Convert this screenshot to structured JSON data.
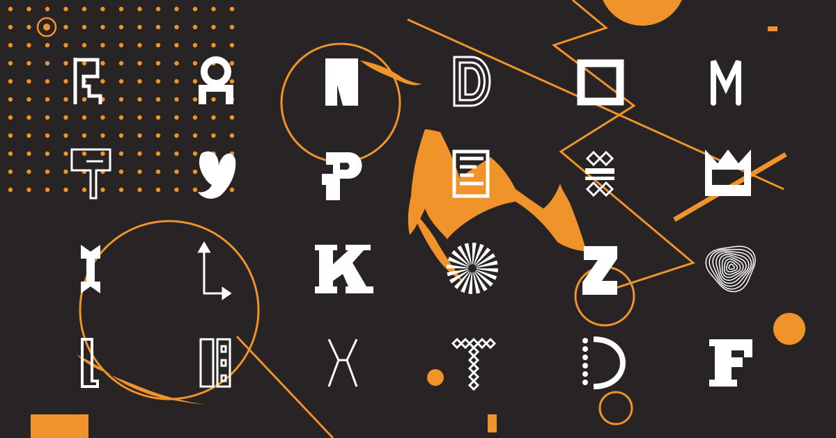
{
  "colors": {
    "background": "#282425",
    "accent": "#f0932a",
    "letter": "#ffffff"
  },
  "glyphs": [
    {
      "id": "glyph-hook",
      "shape": "hooked-frame-letter"
    },
    {
      "id": "glyph-ring-arch",
      "shape": "ring-on-arch"
    },
    {
      "id": "glyph-flag-n",
      "shape": "slanted-flag"
    },
    {
      "id": "glyph-d-outline",
      "shape": "multi-line-d"
    },
    {
      "id": "glyph-square-o",
      "shape": "square-o"
    },
    {
      "id": "glyph-m-rounded",
      "shape": "rounded-m"
    },
    {
      "id": "glyph-t-outline",
      "shape": "outlined-t"
    },
    {
      "id": "glyph-y-blob",
      "shape": "blob-y"
    },
    {
      "id": "glyph-p-stencil",
      "shape": "stencil-p"
    },
    {
      "id": "glyph-e-stripes",
      "shape": "striped-e"
    },
    {
      "id": "glyph-diamond-bars",
      "shape": "diamonds-and-bars"
    },
    {
      "id": "glyph-crown",
      "shape": "crown"
    },
    {
      "id": "glyph-i-diamond",
      "shape": "diamond-i"
    },
    {
      "id": "glyph-l-arrows",
      "shape": "arrow-l"
    },
    {
      "id": "glyph-k-slab",
      "shape": "slab-k"
    },
    {
      "id": "glyph-sunburst",
      "shape": "sunburst"
    },
    {
      "id": "glyph-z-stencil",
      "shape": "stencil-z"
    },
    {
      "id": "glyph-contour",
      "shape": "contour-rings"
    },
    {
      "id": "glyph-l-outline",
      "shape": "outlined-l"
    },
    {
      "id": "glyph-bars",
      "shape": "outlined-bars"
    },
    {
      "id": "glyph-x-thin",
      "shape": "thin-x"
    },
    {
      "id": "glyph-t-diamonds",
      "shape": "diamond-t"
    },
    {
      "id": "glyph-d-dotted",
      "shape": "dotted-d"
    },
    {
      "id": "glyph-f-slab",
      "shape": "slab-f"
    }
  ]
}
